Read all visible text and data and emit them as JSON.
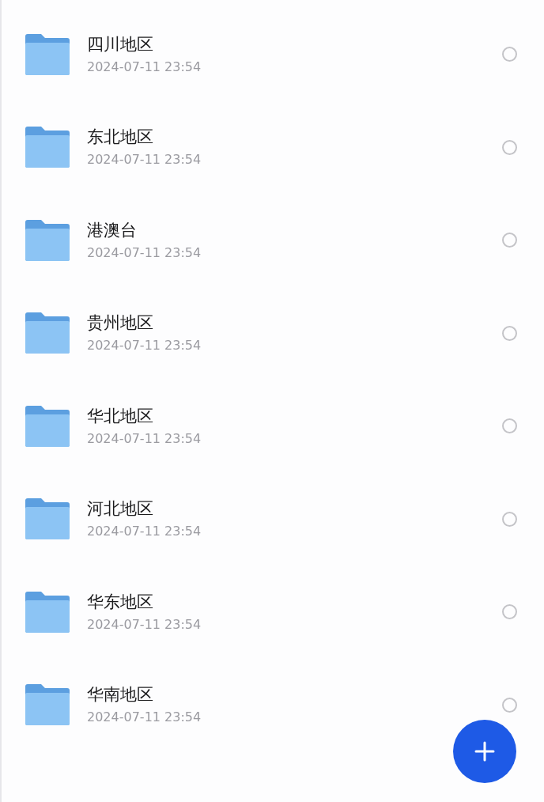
{
  "folders": [
    {
      "name": "四川地区",
      "date": "2024-07-11 23:54",
      "selected": false
    },
    {
      "name": "东北地区",
      "date": "2024-07-11 23:54",
      "selected": false
    },
    {
      "name": "港澳台",
      "date": "2024-07-11 23:54",
      "selected": false
    },
    {
      "name": "贵州地区",
      "date": "2024-07-11 23:54",
      "selected": false
    },
    {
      "name": "华北地区",
      "date": "2024-07-11 23:54",
      "selected": false
    },
    {
      "name": "河北地区",
      "date": "2024-07-11 23:54",
      "selected": false
    },
    {
      "name": "华东地区",
      "date": "2024-07-11 23:54",
      "selected": false
    },
    {
      "name": "华南地区",
      "date": "2024-07-11 23:54",
      "selected": false
    }
  ]
}
